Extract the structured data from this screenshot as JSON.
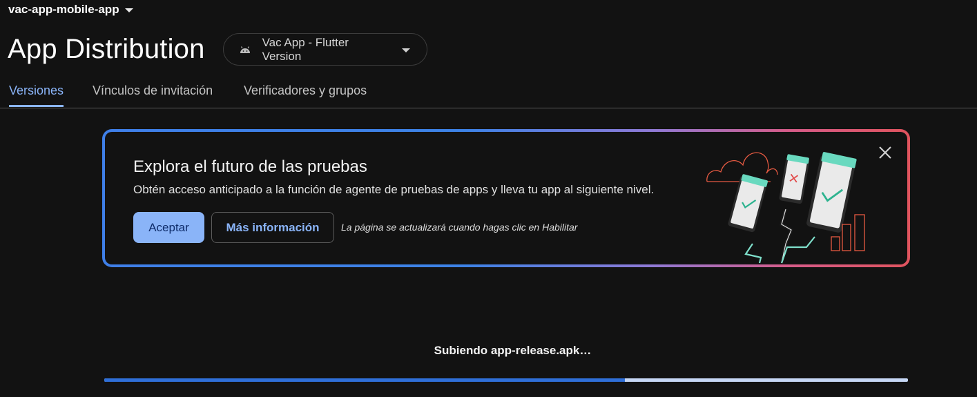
{
  "project": {
    "name": "vac-app-mobile-app"
  },
  "page": {
    "title": "App Distribution"
  },
  "app_selector": {
    "label": "Vac App - Flutter Version",
    "icon": "android-icon"
  },
  "tabs": [
    {
      "label": "Versiones",
      "active": true
    },
    {
      "label": "Vínculos de invitación",
      "active": false
    },
    {
      "label": "Verificadores y grupos",
      "active": false
    }
  ],
  "banner": {
    "title": "Explora el futuro de las pruebas",
    "description": "Obtén acceso anticipado a la función de agente de pruebas de apps y lleva tu app al siguiente nivel.",
    "accept_label": "Aceptar",
    "more_label": "Más información",
    "note": "La página se actualizará cuando hagas clic en Habilitar"
  },
  "upload": {
    "status_text": "Subiendo app-release.apk…",
    "progress": 0.648
  },
  "colors": {
    "accent": "#8ab4f8",
    "background": "#121212",
    "progress_fill": "#2f6fd8",
    "progress_track": "#c6d7f5"
  }
}
